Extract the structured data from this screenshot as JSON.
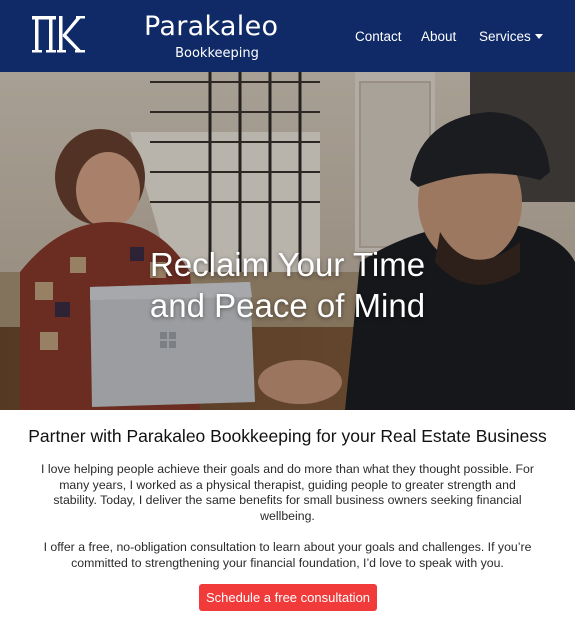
{
  "header": {
    "logo_text": "ΠΚ",
    "brand_title": "Parakaleo",
    "brand_subtitle": "Bookkeeping",
    "nav": {
      "contact": "Contact",
      "about": "About",
      "services": "Services"
    }
  },
  "hero": {
    "heading_line1": "Reclaim Your Time",
    "heading_line2": "and Peace of Mind"
  },
  "main": {
    "title": "Partner with Parakaleo Bookkeeping for your Real Estate Business",
    "paragraph1": "I love helping people achieve their goals and do more than what they thought possible. For many years, I worked as a physical therapist, guiding people to greater strength and stability. Today, I deliver the same benefits for small business owners seeking financial wellbeing.",
    "paragraph2": "I offer a free, no-obligation consultation to learn about your goals and challenges. If you’re committed to strengthening your financial foundation, I’d love to speak with you.",
    "cta_label": "Schedule a free consultation"
  },
  "colors": {
    "navbar": "#0f2a66",
    "cta": "#f13b3b"
  },
  "icons": {
    "logo": "pi-kappa-monogram",
    "services_caret": "caret-down-icon"
  }
}
